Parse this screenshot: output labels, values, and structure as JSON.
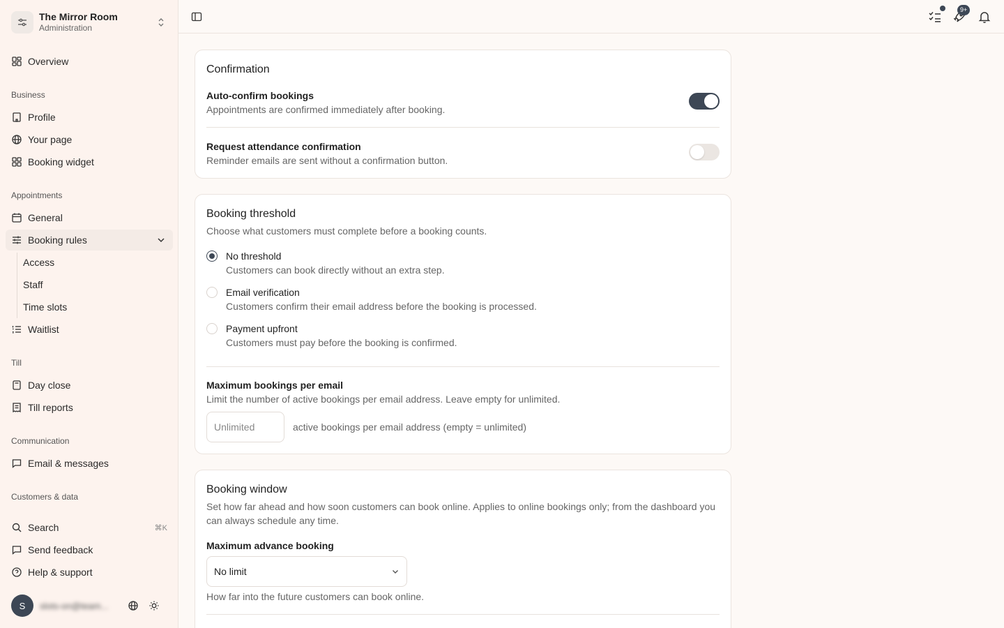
{
  "org": {
    "name": "The Mirror Room",
    "subtitle": "Administration"
  },
  "sidebar": {
    "overview": "Overview",
    "groups": {
      "business": "Business",
      "appointments": "Appointments",
      "till": "Till",
      "communication": "Communication",
      "customers": "Customers & data"
    },
    "business_items": [
      "Profile",
      "Your page",
      "Booking widget"
    ],
    "appointments_items": [
      "General",
      "Booking rules",
      "Waitlist"
    ],
    "booking_rules_sub": [
      "Access",
      "Staff",
      "Time slots"
    ],
    "till_items": [
      "Day close",
      "Till reports"
    ],
    "communication_items": [
      "Email & messages"
    ],
    "footer_items": [
      "Search",
      "Send feedback",
      "Help & support"
    ],
    "search_shortcut": "⌘K",
    "user": {
      "initial": "S",
      "email": "slots-on@team..."
    }
  },
  "topbar": {
    "badge": "9+"
  },
  "confirmation": {
    "title": "Confirmation",
    "auto_confirm": {
      "title": "Auto-confirm bookings",
      "desc": "Appointments are confirmed immediately after booking.",
      "enabled": true
    },
    "attendance": {
      "title": "Request attendance confirmation",
      "desc": "Reminder emails are sent without a confirmation button.",
      "enabled": false
    }
  },
  "threshold": {
    "title": "Booking threshold",
    "desc": "Choose what customers must complete before a booking counts.",
    "options": [
      {
        "title": "No threshold",
        "desc": "Customers can book directly without an extra step.",
        "checked": true
      },
      {
        "title": "Email verification",
        "desc": "Customers confirm their email address before the booking is processed.",
        "checked": false
      },
      {
        "title": "Payment upfront",
        "desc": "Customers must pay before the booking is confirmed.",
        "checked": false
      }
    ],
    "max_per_email": {
      "title": "Maximum bookings per email",
      "desc": "Limit the number of active bookings per email address. Leave empty for unlimited.",
      "placeholder": "Unlimited",
      "suffix": "active bookings per email address (empty = unlimited)"
    }
  },
  "window": {
    "title": "Booking window",
    "desc": "Set how far ahead and how soon customers can book online. Applies to online bookings only; from the dashboard you can always schedule any time.",
    "max_advance": {
      "title": "Maximum advance booking",
      "value": "No limit",
      "hint": "How far into the future customers can book online."
    }
  },
  "colors": {
    "accent": "#3d4755",
    "sidebar_bg": "#fdf3ee",
    "page_bg": "#fdf9f6"
  }
}
